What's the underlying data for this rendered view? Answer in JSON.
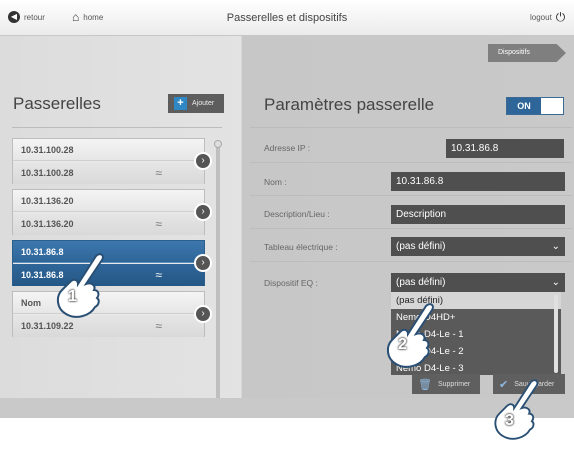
{
  "topbar": {
    "back_label": "retour",
    "home_label": "home",
    "title": "Passerelles et dispositifs",
    "logout_label": "logout"
  },
  "dispositifs_tab": "Dispositifs",
  "left": {
    "title": "Passerelles",
    "add_label": "Ajouter",
    "cards": [
      {
        "name": "10.31.100.28",
        "ip": "10.31.100.28",
        "selected": false
      },
      {
        "name": "10.31.136.20",
        "ip": "10.31.136.20",
        "selected": false
      },
      {
        "name": "10.31.86.8",
        "ip": "10.31.86.8",
        "selected": true
      },
      {
        "name": "Nom",
        "ip": "10.31.109.22",
        "selected": false
      }
    ]
  },
  "right": {
    "title": "Paramètres passerelle",
    "toggle_label": "ON",
    "fields": {
      "ip_label": "Adresse IP :",
      "ip_value": "10.31.86.8",
      "name_label": "Nom :",
      "name_value": "10.31.86.8",
      "desc_label": "Description/Lieu :",
      "desc_value": "Description",
      "panel_label": "Tableau électrique :",
      "panel_value": "(pas défini)",
      "eq_label": "Dispositif EQ :",
      "eq_value": "(pas défini)"
    },
    "dropdown_options": [
      "(pas défini)",
      "Nemo D4HD+",
      "Nemo D4-Le - 1",
      "Nemo D4-Le - 2",
      "Nemo D4-Le - 3"
    ],
    "delete_label": "Supprimer",
    "save_label": "Sauvegarder"
  },
  "steps": [
    "1",
    "2",
    "3"
  ],
  "colors": {
    "selected_blue": "#2f6699",
    "field_dark": "#4f4f4f",
    "accent_plus": "#2f88c4"
  }
}
